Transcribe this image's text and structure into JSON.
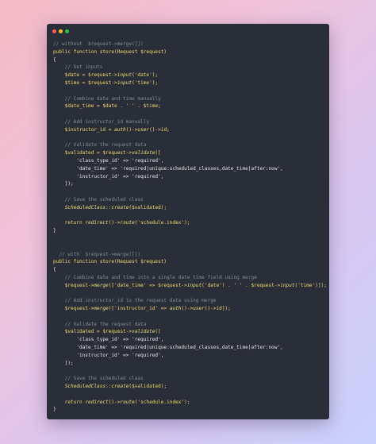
{
  "window": {
    "controls": [
      {
        "name": "close",
        "color": "#ff5f57"
      },
      {
        "name": "minimize",
        "color": "#febc2e"
      },
      {
        "name": "maximize",
        "color": "#28c840"
      }
    ]
  },
  "code": {
    "lines": [
      [
        {
          "t": "// without  $request->merge([])",
          "c": "comment"
        }
      ],
      [
        {
          "t": "public function ",
          "c": "kw"
        },
        {
          "t": "store",
          "c": "kw"
        },
        {
          "t": "(Request $request)",
          "c": "kw"
        }
      ],
      [
        {
          "t": "{",
          "c": "op"
        }
      ],
      [
        {
          "t": "    // Get inputs",
          "c": "comment"
        }
      ],
      [
        {
          "t": "    $date = $request->",
          "c": "kw"
        },
        {
          "t": "input",
          "c": "func"
        },
        {
          "t": "('date');",
          "c": "kw"
        }
      ],
      [
        {
          "t": "    $time = $request->",
          "c": "kw"
        },
        {
          "t": "input",
          "c": "func"
        },
        {
          "t": "('time');",
          "c": "kw"
        }
      ],
      [
        {
          "t": "",
          "c": "op"
        }
      ],
      [
        {
          "t": "    // Combine date and time manually",
          "c": "comment"
        }
      ],
      [
        {
          "t": "    $date_time = $date . ' ' . $time;",
          "c": "kw"
        }
      ],
      [
        {
          "t": "",
          "c": "op"
        }
      ],
      [
        {
          "t": "    // Add instructor_id manually",
          "c": "comment"
        }
      ],
      [
        {
          "t": "    $instructor_id = ",
          "c": "kw"
        },
        {
          "t": "auth",
          "c": "func"
        },
        {
          "t": "()->",
          "c": "kw"
        },
        {
          "t": "user",
          "c": "func"
        },
        {
          "t": "()->id;",
          "c": "kw"
        }
      ],
      [
        {
          "t": "",
          "c": "op"
        }
      ],
      [
        {
          "t": "    // Validate the request data",
          "c": "comment"
        }
      ],
      [
        {
          "t": "    $validated = $request->",
          "c": "kw"
        },
        {
          "t": "validate",
          "c": "func"
        },
        {
          "t": "([",
          "c": "kw"
        }
      ],
      [
        {
          "t": "        'class_type_id' => 'required',",
          "c": "op"
        }
      ],
      [
        {
          "t": "        'date_time' => 'required|unique:scheduled_classes,date_time|after:now',",
          "c": "op"
        }
      ],
      [
        {
          "t": "        'instructor_id' => 'required',",
          "c": "op"
        }
      ],
      [
        {
          "t": "    ]);",
          "c": "op"
        }
      ],
      [
        {
          "t": "",
          "c": "op"
        }
      ],
      [
        {
          "t": "    // Save the scheduled class",
          "c": "comment"
        }
      ],
      [
        {
          "t": "    ",
          "c": "op"
        },
        {
          "t": "ScheduledClass",
          "c": "cls"
        },
        {
          "t": "::",
          "c": "kw"
        },
        {
          "t": "create",
          "c": "func"
        },
        {
          "t": "($validated);",
          "c": "kw"
        }
      ],
      [
        {
          "t": "",
          "c": "op"
        }
      ],
      [
        {
          "t": "    return ",
          "c": "kw"
        },
        {
          "t": "redirect",
          "c": "func"
        },
        {
          "t": "()->",
          "c": "kw"
        },
        {
          "t": "route",
          "c": "func"
        },
        {
          "t": "('schedule.index');",
          "c": "kw"
        }
      ],
      [
        {
          "t": "}",
          "c": "op"
        }
      ],
      [
        {
          "t": "",
          "c": "op"
        }
      ],
      [
        {
          "t": "",
          "c": "op"
        }
      ],
      [
        {
          "t": "  // with  $request->merge([])",
          "c": "comment"
        }
      ],
      [
        {
          "t": "public function ",
          "c": "kw"
        },
        {
          "t": "store",
          "c": "kw"
        },
        {
          "t": "(Request $request)",
          "c": "kw"
        }
      ],
      [
        {
          "t": "{",
          "c": "op"
        }
      ],
      [
        {
          "t": "    // Combine date and time into a single date_time field using merge",
          "c": "comment"
        }
      ],
      [
        {
          "t": "    $request->",
          "c": "kw"
        },
        {
          "t": "merge",
          "c": "func"
        },
        {
          "t": "(['date_time' => $request->",
          "c": "kw"
        },
        {
          "t": "input",
          "c": "func"
        },
        {
          "t": "('date') . ' ' . $request->",
          "c": "kw"
        },
        {
          "t": "input",
          "c": "func"
        },
        {
          "t": "('time')]);",
          "c": "kw"
        }
      ],
      [
        {
          "t": "",
          "c": "op"
        }
      ],
      [
        {
          "t": "    // Add instructor_id to the request data using merge",
          "c": "comment"
        }
      ],
      [
        {
          "t": "    $request->",
          "c": "kw"
        },
        {
          "t": "merge",
          "c": "func"
        },
        {
          "t": "(['instructor_id' => ",
          "c": "kw"
        },
        {
          "t": "auth",
          "c": "func"
        },
        {
          "t": "()->",
          "c": "kw"
        },
        {
          "t": "user",
          "c": "func"
        },
        {
          "t": "()->id]);",
          "c": "kw"
        }
      ],
      [
        {
          "t": "",
          "c": "op"
        }
      ],
      [
        {
          "t": "    // Validate the request data",
          "c": "comment"
        }
      ],
      [
        {
          "t": "    $validated = $request->",
          "c": "kw"
        },
        {
          "t": "validate",
          "c": "func"
        },
        {
          "t": "([",
          "c": "kw"
        }
      ],
      [
        {
          "t": "        'class_type_id' => 'required',",
          "c": "op"
        }
      ],
      [
        {
          "t": "        'date_time' => 'required|unique:scheduled_classes,date_time|after:now',",
          "c": "op"
        }
      ],
      [
        {
          "t": "        'instructor_id' => 'required',",
          "c": "op"
        }
      ],
      [
        {
          "t": "    ]);",
          "c": "op"
        }
      ],
      [
        {
          "t": "",
          "c": "op"
        }
      ],
      [
        {
          "t": "    // Save the scheduled class",
          "c": "comment"
        }
      ],
      [
        {
          "t": "    ",
          "c": "op"
        },
        {
          "t": "ScheduledClass",
          "c": "cls"
        },
        {
          "t": "::",
          "c": "kw"
        },
        {
          "t": "create",
          "c": "func"
        },
        {
          "t": "($validated);",
          "c": "kw"
        }
      ],
      [
        {
          "t": "",
          "c": "op"
        }
      ],
      [
        {
          "t": "    return ",
          "c": "kw"
        },
        {
          "t": "redirect",
          "c": "func"
        },
        {
          "t": "()->",
          "c": "kw"
        },
        {
          "t": "route",
          "c": "func"
        },
        {
          "t": "('schedule.index');",
          "c": "kw"
        }
      ],
      [
        {
          "t": "}",
          "c": "op"
        }
      ]
    ]
  }
}
